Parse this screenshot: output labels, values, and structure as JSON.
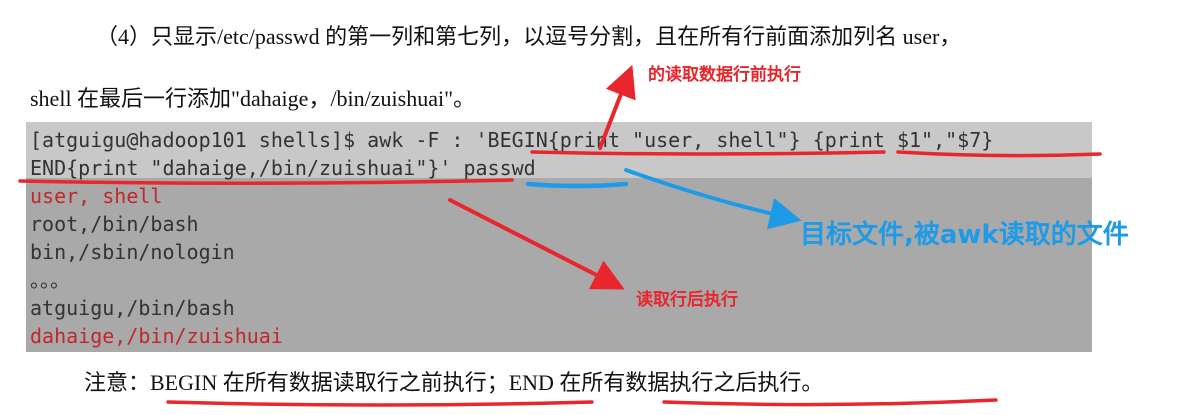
{
  "paragraph": {
    "line1": "（4）只显示/etc/passwd 的第一列和第七列，以逗号分割，且在所有行前面添加列名 user，",
    "line2": "shell 在最后一行添加\"dahaige，/bin/zuishuai\"。"
  },
  "code": {
    "lines": [
      "[atguigu@hadoop101 shells]$ awk -F : 'BEGIN{print \"user, shell\"} {print $1\",\"$7}",
      "END{print \"dahaige,/bin/zuishuai\"}' passwd",
      "user, shell",
      "root,/bin/bash",
      "bin,/sbin/nologin",
      "。。。",
      "atguigu,/bin/bash",
      "dahaige,/bin/zuishuai"
    ]
  },
  "note": "注意：BEGIN  在所有数据读取行之前执行；END  在所有数据执行之后执行。",
  "annotations": {
    "begin": "的读取数据行前执行",
    "target_file": "目标文件,被awk读取的文件",
    "end": "读取行后执行"
  },
  "colors": {
    "annotation_red": "#e8262c",
    "annotation_blue": "#1e9be8",
    "output_red": "#c0282b",
    "code_bg": "#c8c8c8",
    "code_bg_dark": "#a9a9a9"
  }
}
